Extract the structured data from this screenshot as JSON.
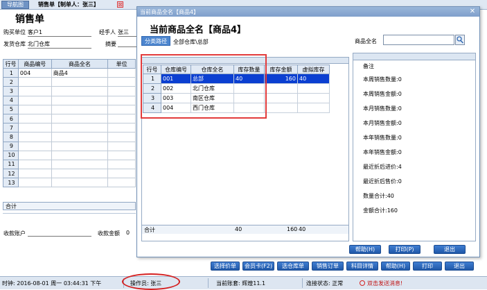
{
  "tabs": {
    "nav": "导航图",
    "sale": "销售单【制单人：张三】",
    "close_glyph": "⊠"
  },
  "form": {
    "title": "销售单",
    "buyer_label": "购买单位",
    "buyer_value": "客户1",
    "handler_label": "经手人",
    "handler_value": "张三",
    "warehouse_label": "发货仓库",
    "warehouse_value": "北门仓库",
    "summary_label": "摘要",
    "columns": [
      "行号",
      "商品编号",
      "商品全名",
      "单位"
    ],
    "rows": [
      {
        "n": "1",
        "code": "004",
        "name": "商品4",
        "unit": ""
      },
      {
        "n": "2",
        "code": "",
        "name": "",
        "unit": ""
      },
      {
        "n": "3",
        "code": "",
        "name": "",
        "unit": ""
      },
      {
        "n": "4",
        "code": "",
        "name": "",
        "unit": ""
      },
      {
        "n": "5",
        "code": "",
        "name": "",
        "unit": ""
      },
      {
        "n": "6",
        "code": "",
        "name": "",
        "unit": ""
      },
      {
        "n": "7",
        "code": "",
        "name": "",
        "unit": ""
      },
      {
        "n": "8",
        "code": "",
        "name": "",
        "unit": ""
      },
      {
        "n": "9",
        "code": "",
        "name": "",
        "unit": ""
      },
      {
        "n": "10",
        "code": "",
        "name": "",
        "unit": ""
      },
      {
        "n": "11",
        "code": "",
        "name": "",
        "unit": ""
      },
      {
        "n": "12",
        "code": "",
        "name": "",
        "unit": ""
      },
      {
        "n": "13",
        "code": "",
        "name": "",
        "unit": ""
      }
    ],
    "total_label": "合计",
    "account_label": "收款账户",
    "amount_label": "收款金额",
    "amount_value": "0"
  },
  "bottom_buttons": [
    "选择价单",
    "会员卡(F2)",
    "选仓库单",
    "销售订单",
    "科目详情",
    "帮助(H)",
    "打印",
    "退出"
  ],
  "status": {
    "time": "时钟: 2016-08-01 周一 03:44:31 下午",
    "operator": "操作员: 张三",
    "ledger": "当前账套: 辉煌11.1",
    "connection": "连接状态: 正常",
    "message": "双击发送消息!"
  },
  "dialog": {
    "window_title": "当前商品全名【商品4】",
    "heading": "当前商品全名【商品4】",
    "category_button": "分类路径",
    "category_path": "全部仓库\\总部",
    "name_label": "商品全名",
    "name_value": "",
    "columns": [
      "行号",
      "仓库编号",
      "仓库全名",
      "库存数量",
      "库存金额",
      "虚拟库存"
    ],
    "rows": [
      {
        "n": "1",
        "code": "001",
        "name": "总部",
        "qty": "40",
        "amount": "160",
        "virtual": "40",
        "selected": true
      },
      {
        "n": "2",
        "code": "002",
        "name": "北门仓库",
        "qty": "",
        "amount": "",
        "virtual": ""
      },
      {
        "n": "3",
        "code": "003",
        "name": "南区仓库",
        "qty": "",
        "amount": "",
        "virtual": ""
      },
      {
        "n": "4",
        "code": "004",
        "name": "西门仓库",
        "qty": "",
        "amount": "",
        "virtual": ""
      }
    ],
    "total": {
      "label": "合计",
      "qty": "40",
      "amount": "160",
      "virtual": "40"
    },
    "remark_label": "备注",
    "stats": [
      "本周销售数量:0",
      "本周销售金额:0",
      "本月销售数量:0",
      "本月销售金额:0",
      "本年销售数量:0",
      "本年销售金额:0",
      "最近折后进价:4",
      "最近折后售价:0",
      "数量合计:40",
      "金额合计:160"
    ],
    "help_button": "帮助(H)",
    "print_button": "打印(P)",
    "exit_button": "退出"
  }
}
